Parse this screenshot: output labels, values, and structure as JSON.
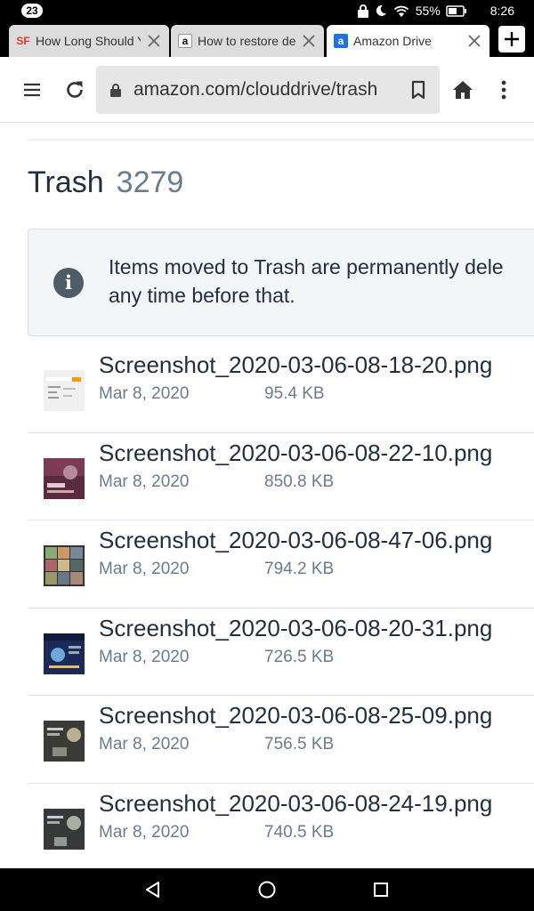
{
  "status_bar": {
    "notification_count": "23",
    "battery": "55%",
    "time": "8:26",
    "icons": [
      "lock-icon",
      "moon-icon",
      "wifi-icon",
      "battery-icon"
    ]
  },
  "tabs": [
    {
      "favicon": "SF",
      "title": "How Long Should Y",
      "active": false
    },
    {
      "favicon": "a",
      "title": "How to restore del",
      "active": false
    },
    {
      "favicon": "a",
      "title": "Amazon Drive",
      "active": true
    }
  ],
  "toolbar": {
    "url": "amazon.com/clouddrive/trash",
    "icons": [
      "menu-icon",
      "reload-icon",
      "lock-icon",
      "bookmark-icon",
      "home-icon",
      "more-icon"
    ]
  },
  "page": {
    "title": "Trash",
    "count": "3279",
    "banner_line1": "Items moved to Trash are permanently dele",
    "banner_line2": "any time before that.",
    "info_glyph": "i"
  },
  "files": [
    {
      "name": "Screenshot_2020-03-06-08-18-20.png",
      "date": "Mar 8, 2020",
      "size": "95.4 KB"
    },
    {
      "name": "Screenshot_2020-03-06-08-22-10.png",
      "date": "Mar 8, 2020",
      "size": "850.8 KB"
    },
    {
      "name": "Screenshot_2020-03-06-08-47-06.png",
      "date": "Mar 8, 2020",
      "size": "794.2 KB"
    },
    {
      "name": "Screenshot_2020-03-06-08-20-31.png",
      "date": "Mar 8, 2020",
      "size": "726.5 KB"
    },
    {
      "name": "Screenshot_2020-03-06-08-25-09.png",
      "date": "Mar 8, 2020",
      "size": "756.5 KB"
    },
    {
      "name": "Screenshot_2020-03-06-08-24-19.png",
      "date": "Mar 8, 2020",
      "size": "740.5 KB"
    }
  ],
  "colors": {
    "title": "#232f3e",
    "muted": "#6b7b90",
    "banner_bg": "#f3f6f9",
    "amazon_orange": "#ff9900",
    "sf_red": "#e4362e",
    "drive_blue": "#1a73e8"
  }
}
